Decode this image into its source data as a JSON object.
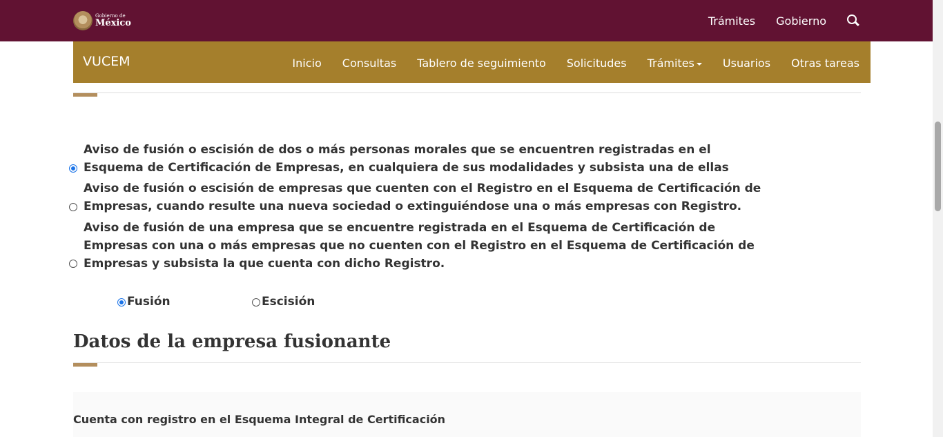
{
  "header": {
    "logo_small": "Gobierno de",
    "logo_big": "México",
    "links": [
      "Trámites",
      "Gobierno"
    ]
  },
  "nav": {
    "brand": "VUCEM",
    "items": [
      "Inicio",
      "Consultas",
      "Tablero de seguimiento",
      "Solicitudes",
      "Trámites",
      "Usuarios",
      "Otras tareas"
    ]
  },
  "options": [
    {
      "text": "Aviso de fusión o escisión de dos o más personas morales que se encuentren registradas en el Esquema de Certificación de Empresas, en cualquiera de sus modalidades y subsista una de ellas",
      "selected": true
    },
    {
      "text": "Aviso de fusión o escisión de empresas que cuenten con el Registro en el Esquema de Certificación de Empresas, cuando resulte una nueva sociedad o extinguiéndose una o más empresas con Registro.",
      "selected": false
    },
    {
      "text": "Aviso de fusión de una empresa que se encuentre registrada en el Esquema de Certificación de Empresas con una o más empresas que no cuenten con el Registro en el Esquema de Certificación de Empresas y subsista la que cuenta con dicho Registro.",
      "selected": false
    }
  ],
  "type_options": [
    {
      "label": "Fusión",
      "selected": true
    },
    {
      "label": "Escisión",
      "selected": false
    }
  ],
  "section": {
    "title": "Datos de la empresa fusionante",
    "field_label": "Cuenta con registro en el Esquema Integral de Certificación"
  },
  "colors": {
    "top_bar": "#611232",
    "nav_bar": "#a57f2c",
    "accent": "#b38e5d",
    "radio_selected": "#1a73e8"
  }
}
